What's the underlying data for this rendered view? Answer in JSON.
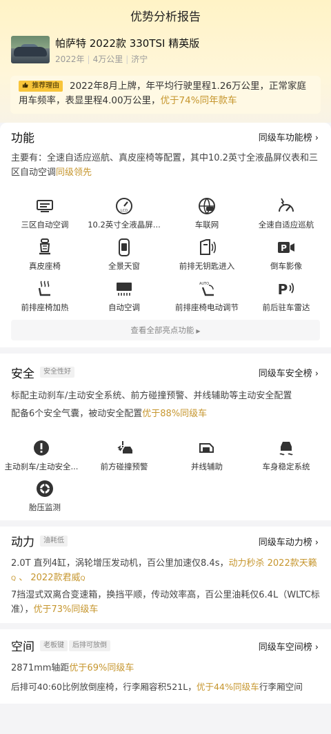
{
  "page": {
    "title": "优势分析报告"
  },
  "car": {
    "name": "帕萨特 2022款 330TSI 精英版",
    "year": "2022年",
    "mileage": "4万公里",
    "city": "济宁"
  },
  "reason": {
    "tag": "推荐理由",
    "text": "2022年8月上牌，年平均行驶里程1.26万公里，正常家庭用车频率，表显里程4.00万公里，",
    "highlight": "优于74%同年款车"
  },
  "function": {
    "title": "功能",
    "rank_label": "同级车功能榜",
    "desc": "主要有：全速自适应巡航、真皮座椅等配置，其中10.2英寸全液晶屏仪表和三区自动空调",
    "desc_highlight": "同级领先",
    "items": [
      {
        "label": "三区自动空调",
        "icon": "ac-panel-icon"
      },
      {
        "label": "10.2英寸全液晶屏...",
        "icon": "lcd-gauge-icon"
      },
      {
        "label": "车联网",
        "icon": "connected-car-icon"
      },
      {
        "label": "全速自适应巡航",
        "icon": "adaptive-cruise-icon"
      },
      {
        "label": "真皮座椅",
        "icon": "leather-seat-icon"
      },
      {
        "label": "全景天窗",
        "icon": "panoramic-sunroof-icon"
      },
      {
        "label": "前排无钥匙进入",
        "icon": "keyless-entry-icon"
      },
      {
        "label": "倒车影像",
        "icon": "reverse-camera-icon"
      },
      {
        "label": "前排座椅加热",
        "icon": "seat-heating-icon"
      },
      {
        "label": "自动空调",
        "icon": "auto-ac-icon"
      },
      {
        "label": "前排座椅电动调节",
        "icon": "power-seat-icon"
      },
      {
        "label": "前后驻车雷达",
        "icon": "parking-radar-icon"
      }
    ],
    "more_label": "查看全部亮点功能"
  },
  "safety": {
    "title": "安全",
    "badge": "安全性好",
    "rank_label": "同级车安全榜",
    "desc1": "标配主动刹车/主动安全系统、前方碰撞预警、并线辅助等主动安全配置",
    "desc2": "配备6个安全气囊，被动安全配置",
    "desc2_highlight": "优于88%同级车",
    "items": [
      {
        "label": "主动刹车/主动安全...",
        "icon": "active-brake-icon"
      },
      {
        "label": "前方碰撞预警",
        "icon": "collision-warning-icon"
      },
      {
        "label": "并线辅助",
        "icon": "lane-assist-icon"
      },
      {
        "label": "车身稳定系统",
        "icon": "stability-control-icon"
      },
      {
        "label": "胎压监测",
        "icon": "tire-pressure-icon"
      }
    ]
  },
  "power": {
    "title": "动力",
    "badge": "油耗低",
    "rank_label": "同级车动力榜",
    "desc1": "2.0T 直列4缸，涡轮增压发动机，百公里加速仅8.4s，",
    "desc1_highlight": "动力秒杀",
    "link1": "2022款天籁",
    "link_sep": "、",
    "link2": "2022款君威",
    "desc2": "7挡湿式双离合变速箱，换挡平顺，传动效率高，百公里油耗仅6.4L（WLTC标准），",
    "desc2_highlight": "优于73%同级车"
  },
  "space": {
    "title": "空间",
    "badge1": "老板键",
    "badge2": "后排可放倒",
    "rank_label": "同级车空间榜",
    "desc1": "2871mm轴距",
    "desc1_highlight": "优于69%同级车",
    "desc2": "后排可40:60比例放倒座椅，行李厢容积521L，",
    "desc2_highlight": "优于44%同级车",
    "desc2_tail": "行李厢空间"
  },
  "colors": {
    "accent": "#c6962e",
    "tag_bg": "#f8c53a"
  }
}
